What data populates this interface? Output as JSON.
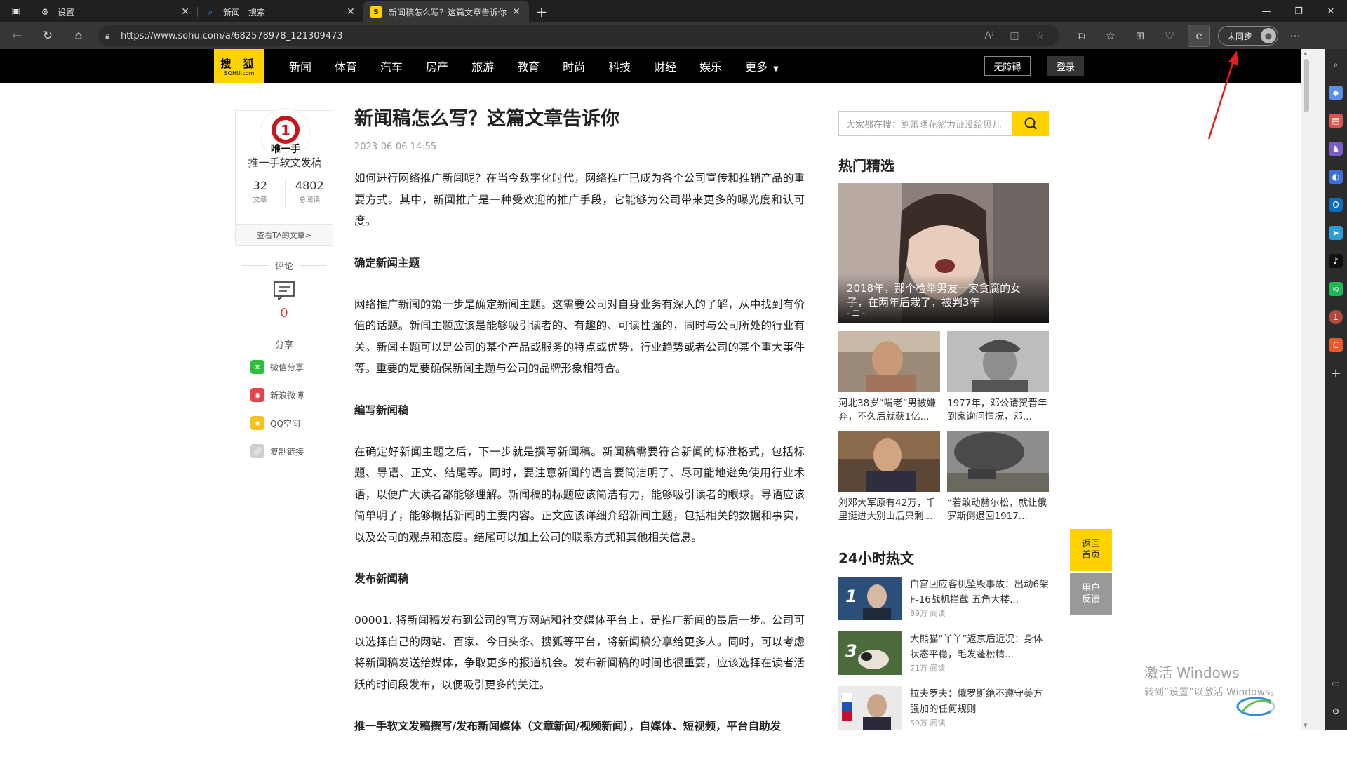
{
  "browser": {
    "tabs": [
      {
        "title": "设置",
        "icon": "gear-icon",
        "active": false
      },
      {
        "title": "新闻 - 搜索",
        "icon": "search-icon",
        "active": false
      },
      {
        "title": "新闻稿怎么写？这篇文章告诉你",
        "icon": "sohu-icon",
        "active": true
      }
    ],
    "url": "https://www.sohu.com/a/682578978_121309473",
    "sync_label": "未同步"
  },
  "sohu_nav": {
    "logo_main": "搜 狐",
    "logo_sub": "SOHU.com",
    "items": [
      "新闻",
      "体育",
      "汽车",
      "房产",
      "旅游",
      "教育",
      "时尚",
      "科技",
      "财经",
      "娱乐",
      "更多"
    ],
    "accessibility": "无障碍",
    "login": "登录"
  },
  "author": {
    "logo_text": "唯一手",
    "name": "推一手软文发稿",
    "articles": "32",
    "articles_label": "文章",
    "reads": "4802",
    "reads_label": "总阅读",
    "more": "查看TA的文章>"
  },
  "comments": {
    "title": "评论",
    "count": "0"
  },
  "share": {
    "title": "分享",
    "items": [
      "微信分享",
      "新浪微博",
      "QQ空间",
      "复制链接"
    ]
  },
  "article": {
    "title": "新闻稿怎么写？这篇文章告诉你",
    "time": "2023-06-06 14:55",
    "p1": "如何进行网络推广新闻呢？在当今数字化时代，网络推广已成为各个公司宣传和推销产品的重要方式。其中，新闻推广是一种受欢迎的推广手段，它能够为公司带来更多的曝光度和认可度。",
    "h1": "确定新闻主题",
    "p2": "网络推广新闻的第一步是确定新闻主题。这需要公司对自身业务有深入的了解，从中找到有价值的话题。新闻主题应该是能够吸引读者的、有趣的、可读性强的，同时与公司所处的行业有关。新闻主题可以是公司的某个产品或服务的特点或优势，行业趋势或者公司的某个重大事件等。重要的是要确保新闻主题与公司的品牌形象相符合。",
    "h2": "编写新闻稿",
    "p3": "在确定好新闻主题之后，下一步就是撰写新闻稿。新闻稿需要符合新闻的标准格式，包括标题、导语、正文、结尾等。同时，要注意新闻的语言要简洁明了、尽可能地避免使用行业术语，以便广大读者都能够理解。新闻稿的标题应该简洁有力，能够吸引读者的眼球。导语应该简单明了，能够概括新闻的主要内容。正文应该详细介绍新闻主题，包括相关的数据和事实，以及公司的观点和态度。结尾可以加上公司的联系方式和其他相关信息。",
    "h3": "发布新闻稿",
    "p4": "00001. 将新闻稿发布到公司的官方网站和社交媒体平台上，是推广新闻的最后一步。公司可以选择自己的网站、百家、今日头条、搜狐等平台，将新闻稿分享给更多人。同时，可以考虑将新闻稿发送给媒体，争取更多的报道机会。发布新闻稿的时间也很重要，应该选择在读者活跃的时间段发布，以便吸引更多的关注。",
    "h4": "推一手软文发稿撰写/发布新闻媒体（文章新闻/视频新闻），自媒体、短视频，平台自助发"
  },
  "right": {
    "search_placeholder": "大家都在搜：鲍蕾晒花絮力证没给贝儿",
    "hot_title": "热门精选",
    "hot_big_caption": "2018年，那个检举男友一家贪腐的女子，在两年后栽了，被判3年",
    "hot_big_more": "- 二 -",
    "hot_small": [
      "河北38岁“啃老”男被嫌弃，不久后就获1亿...",
      "1977年，邓公请贺晋年到家询问情况，邓...",
      "刘邓大军原有42万，千里挺进大别山后只剩...",
      "“若敢动赫尔松，就让俄罗斯倒退回1917..."
    ],
    "hot24_title": "24小时热文",
    "hot24": [
      {
        "rank": "1",
        "title": "白宫回应客机坠毁事故：出动6架F-16战机拦截 五角大楼...",
        "reads": "89万 阅读"
      },
      {
        "rank": "3",
        "title": "大熊猫“丫丫”返京后近况：身体状态平稳，毛发蓬松精...",
        "reads": "71万 阅读"
      },
      {
        "rank": "",
        "title": "拉夫罗夫：俄罗斯绝不遵守美方强加的任何规则",
        "reads": "59万 阅读"
      }
    ],
    "float_home": "返回首页",
    "float_feedback": "用户反馈"
  },
  "os": {
    "activate_title": "激活 Windows",
    "activate_sub": "转到“设置”以激活 Windows。"
  },
  "colors": {
    "sohu_yellow": "#ffd200",
    "nav_black": "#000000",
    "chrome_dark": "#202020",
    "annotation_red": "#e02020"
  }
}
